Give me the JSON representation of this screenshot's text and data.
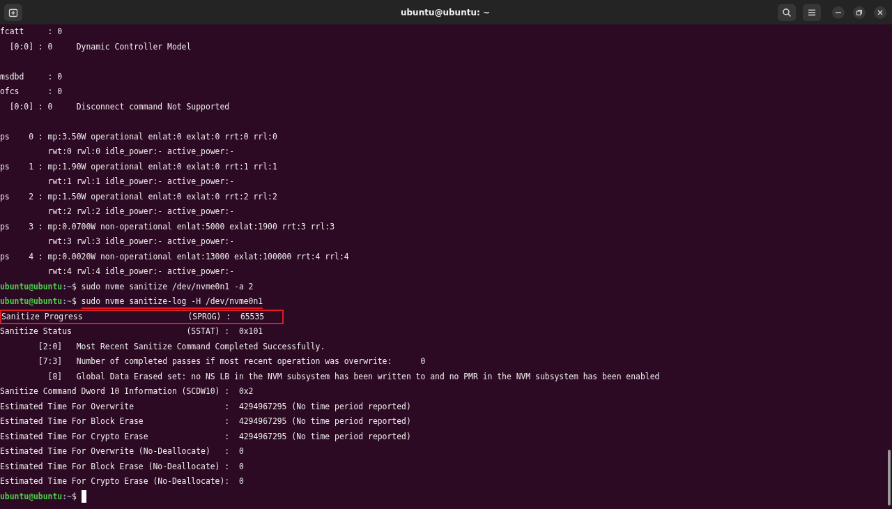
{
  "window": {
    "title": "ubuntu@ubuntu: ~"
  },
  "lines": [
    {
      "kind": "output",
      "text": "fcatt     : 0",
      "boxed": false
    },
    {
      "kind": "output",
      "text": "  [0:0] : 0     Dynamic Controller Model",
      "boxed": false
    },
    {
      "kind": "blank"
    },
    {
      "kind": "output",
      "text": "msdbd     : 0",
      "boxed": false
    },
    {
      "kind": "output",
      "text": "ofcs      : 0",
      "boxed": false
    },
    {
      "kind": "output",
      "text": "  [0:0] : 0     Disconnect command Not Supported",
      "boxed": false
    },
    {
      "kind": "blank"
    },
    {
      "kind": "output",
      "text": "ps    0 : mp:3.50W operational enlat:0 exlat:0 rrt:0 rrl:0",
      "boxed": false
    },
    {
      "kind": "output",
      "text": "          rwt:0 rwl:0 idle_power:- active_power:-",
      "boxed": false
    },
    {
      "kind": "output",
      "text": "ps    1 : mp:1.90W operational enlat:0 exlat:0 rrt:1 rrl:1",
      "boxed": false
    },
    {
      "kind": "output",
      "text": "          rwt:1 rwl:1 idle_power:- active_power:-",
      "boxed": false
    },
    {
      "kind": "output",
      "text": "ps    2 : mp:1.50W operational enlat:0 exlat:0 rrt:2 rrl:2",
      "boxed": false
    },
    {
      "kind": "output",
      "text": "          rwt:2 rwl:2 idle_power:- active_power:-",
      "boxed": false
    },
    {
      "kind": "output",
      "text": "ps    3 : mp:0.0700W non-operational enlat:5000 exlat:1900 rrt:3 rrl:3",
      "boxed": false
    },
    {
      "kind": "output",
      "text": "          rwt:3 rwl:3 idle_power:- active_power:-",
      "boxed": false
    },
    {
      "kind": "output",
      "text": "ps    4 : mp:0.0020W non-operational enlat:13000 exlat:100000 rrt:4 rrl:4",
      "boxed": false
    },
    {
      "kind": "output",
      "text": "          rwt:4 rwl:4 idle_power:- active_power:-",
      "boxed": false
    },
    {
      "kind": "prompt",
      "user": "ubuntu@ubuntu",
      "path": ":~",
      "symbol": "$",
      "command": "sudo nvme sanitize /dev/nvme0n1 -a 2",
      "underlined": false,
      "cursor": false
    },
    {
      "kind": "prompt",
      "user": "ubuntu@ubuntu",
      "path": ":~",
      "symbol": "$",
      "command": "sudo nvme sanitize-log -H /dev/nvme0n1",
      "underlined": true,
      "cursor": false
    },
    {
      "kind": "output",
      "text": "Sanitize Progress                      (SPROG) :  65535",
      "boxed": true
    },
    {
      "kind": "output",
      "text": "Sanitize Status                        (SSTAT) :  0x101",
      "boxed": false
    },
    {
      "kind": "output",
      "text": "        [2:0]   Most Recent Sanitize Command Completed Successfully.",
      "boxed": false
    },
    {
      "kind": "output",
      "text": "        [7:3]   Number of completed passes if most recent operation was overwrite:      0",
      "boxed": false
    },
    {
      "kind": "output",
      "text": "          [8]   Global Data Erased set: no NS LB in the NVM subsystem has been written to and no PMR in the NVM subsystem has been enabled",
      "boxed": false
    },
    {
      "kind": "output",
      "text": "Sanitize Command Dword 10 Information (SCDW10) :  0x2",
      "boxed": false
    },
    {
      "kind": "output",
      "text": "Estimated Time For Overwrite                   :  4294967295 (No time period reported)",
      "boxed": false
    },
    {
      "kind": "output",
      "text": "Estimated Time For Block Erase                 :  4294967295 (No time period reported)",
      "boxed": false
    },
    {
      "kind": "output",
      "text": "Estimated Time For Crypto Erase                :  4294967295 (No time period reported)",
      "boxed": false
    },
    {
      "kind": "output",
      "text": "Estimated Time For Overwrite (No-Deallocate)   :  0",
      "boxed": false
    },
    {
      "kind": "output",
      "text": "Estimated Time For Block Erase (No-Deallocate) :  0",
      "boxed": false
    },
    {
      "kind": "output",
      "text": "Estimated Time For Crypto Erase (No-Deallocate):  0",
      "boxed": false
    },
    {
      "kind": "prompt",
      "user": "ubuntu@ubuntu",
      "path": ":~",
      "symbol": "$",
      "cursor": true
    }
  ]
}
